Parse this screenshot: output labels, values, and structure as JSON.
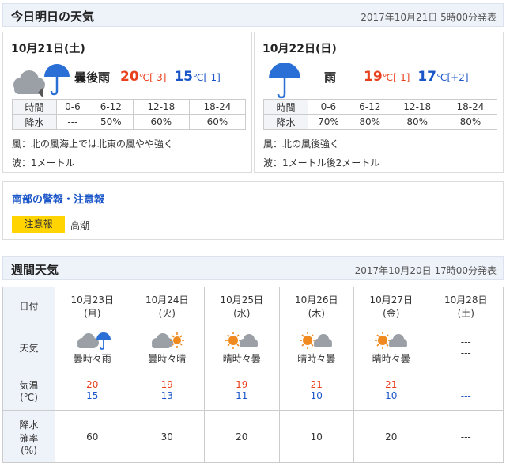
{
  "today_section": {
    "title": "今日明日の天気",
    "published": "2017年10月21日 5時00分発表",
    "days": [
      {
        "date": "10月21日(土)",
        "weather": "曇後雨",
        "weather_icon": "cloud-then-umbrella-icon",
        "high": "20",
        "high_unit": "℃",
        "high_diff": "[-3]",
        "low": "15",
        "low_unit": "℃",
        "low_diff": "[-1]",
        "precip": {
          "time_label": "時間",
          "rain_label": "降水",
          "periods": [
            "0-6",
            "6-12",
            "12-18",
            "18-24"
          ],
          "values": [
            "---",
            "50%",
            "60%",
            "60%"
          ]
        },
        "wind": "風：北の風海上では北東の風やや強く",
        "wave": "波：1メートル"
      },
      {
        "date": "10月22日(日)",
        "weather": "雨",
        "weather_icon": "umbrella-icon",
        "high": "19",
        "high_unit": "℃",
        "high_diff": "[-1]",
        "low": "17",
        "low_unit": "℃",
        "low_diff": "[+2]",
        "precip": {
          "time_label": "時間",
          "rain_label": "降水",
          "periods": [
            "0-6",
            "6-12",
            "12-18",
            "18-24"
          ],
          "values": [
            "70%",
            "80%",
            "80%",
            "80%"
          ]
        },
        "wind": "風：北の風後強く",
        "wave": "波：1メートル後2メートル"
      }
    ]
  },
  "warnings": {
    "title": "南部の警報・注意報",
    "badge": "注意報",
    "items": "高潮"
  },
  "weekly": {
    "title": "週間天気",
    "published": "2017年10月20日 17時00分発表",
    "row_labels": {
      "date": "日付",
      "weather": "天気",
      "temp_1": "気温",
      "temp_2": "(℃)",
      "precip_1": "降水",
      "precip_2": "確率",
      "precip_3": "(%)"
    },
    "days": [
      {
        "date": "10月23日",
        "dow": "(月)",
        "icon": "cloud-umbrella-icon",
        "weather": "曇時々雨",
        "high": "20",
        "low": "15",
        "precip": "60"
      },
      {
        "date": "10月24日",
        "dow": "(火)",
        "icon": "cloud-sun-icon",
        "weather": "曇時々晴",
        "high": "19",
        "low": "13",
        "precip": "30"
      },
      {
        "date": "10月25日",
        "dow": "(水)",
        "icon": "sun-cloud-icon",
        "weather": "晴時々曇",
        "high": "19",
        "low": "11",
        "precip": "20"
      },
      {
        "date": "10月26日",
        "dow": "(木)",
        "icon": "sun-cloud-icon",
        "weather": "晴時々曇",
        "high": "21",
        "low": "10",
        "precip": "10"
      },
      {
        "date": "10月27日",
        "dow": "(金)",
        "icon": "sun-cloud-icon",
        "weather": "晴時々曇",
        "high": "21",
        "low": "10",
        "precip": "20"
      },
      {
        "date": "10月28日",
        "dow": "(土)",
        "icon": "none",
        "weather_1": "---",
        "weather_2": "---",
        "high": "---",
        "low": "---",
        "precip": "---"
      }
    ]
  },
  "colors": {
    "high": "#e8401c",
    "low": "#1a56c8",
    "header_bg": "#eef2f9",
    "badge": "#ffd400"
  }
}
